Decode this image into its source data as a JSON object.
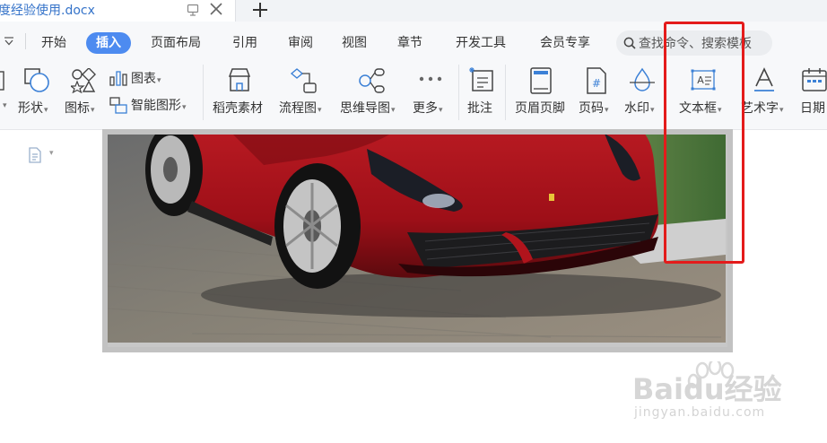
{
  "document": {
    "title": "度经验使用.docx"
  },
  "menu": {
    "items": [
      "开始",
      "插入",
      "页面布局",
      "引用",
      "审阅",
      "视图",
      "章节",
      "开发工具",
      "会员专享"
    ],
    "active": "插入",
    "search_placeholder": "查找命令、搜索模板"
  },
  "ribbon": {
    "shape": "形状",
    "icon": "图标",
    "chart": "图表",
    "smart_graphic": "智能图形",
    "daoke": "稻壳素材",
    "flowchart": "流程图",
    "mindmap": "思维导图",
    "more": "更多",
    "comment": "批注",
    "header_footer": "页眉页脚",
    "page_number": "页码",
    "watermark": "水印",
    "textbox": "文本框",
    "wordart": "艺术字",
    "date": "日期"
  },
  "colors": {
    "accent": "#4d8bf0",
    "highlight": "#e41b1b",
    "title": "#3573c9"
  },
  "site_watermark": {
    "brand": "Baidu经验",
    "url": "jingyan.baidu.com"
  }
}
